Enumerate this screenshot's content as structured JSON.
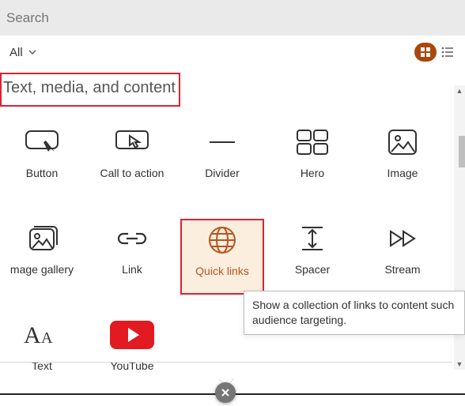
{
  "search": {
    "placeholder": "Search"
  },
  "filter": {
    "label": "All"
  },
  "section": {
    "title": "Text, media, and content"
  },
  "grid": {
    "button": "Button",
    "cta": "Call to action",
    "divider": "Divider",
    "hero": "Hero",
    "image": "Image",
    "gallery": "mage gallery",
    "link": "Link",
    "quicklinks": "Quick links",
    "spacer": "Spacer",
    "stream": "Stream",
    "text": "Text",
    "youtube": "YouTube"
  },
  "tooltip": {
    "text": "Show a collection of links to content such audience targeting."
  },
  "colors": {
    "accent": "#b8551e",
    "highlight": "#d23"
  }
}
